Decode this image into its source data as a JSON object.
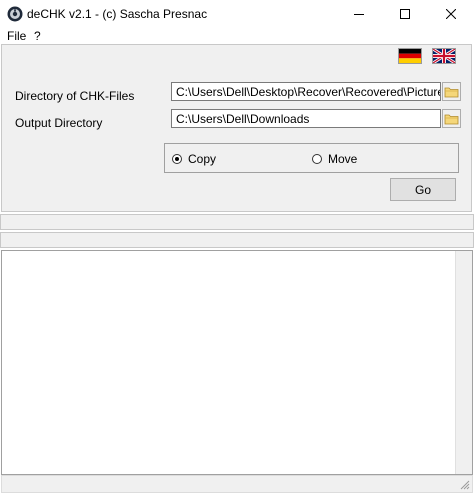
{
  "window": {
    "title": "deCHK v2.1 - (c) Sascha Presnac",
    "app_icon": "app-icon",
    "controls": [
      "minimize-icon",
      "maximize-icon",
      "close-icon"
    ]
  },
  "menu": {
    "items": [
      {
        "label": "File"
      },
      {
        "label": "?"
      }
    ]
  },
  "languages": [
    "german-flag-icon",
    "english-flag-icon"
  ],
  "form": {
    "chk_label": "Directory of CHK-Files",
    "chk_value": "C:\\Users\\Dell\\Desktop\\Recover\\Recovered\\Pictures",
    "out_label": "Output Directory",
    "out_value": "C:\\Users\\Dell\\Downloads",
    "browse_icon": "folder-icon"
  },
  "mode": {
    "options": [
      {
        "label": "Copy",
        "selected": true
      },
      {
        "label": "Move",
        "selected": false
      }
    ]
  },
  "go_label": "Go"
}
